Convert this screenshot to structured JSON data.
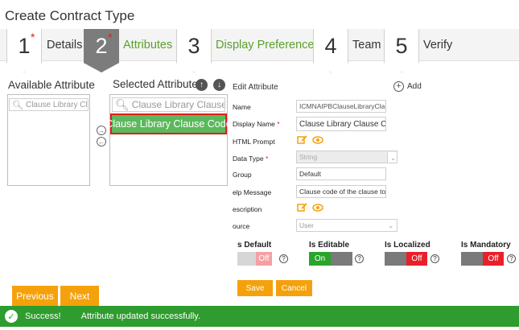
{
  "page": {
    "title": "Create Contract Type"
  },
  "wizard": {
    "steps": [
      {
        "number": "1",
        "label": "Details",
        "required_mark": "*"
      },
      {
        "number": "2",
        "label": "Attributes",
        "required_mark": "*"
      },
      {
        "number": "3",
        "label": "Display Preference"
      },
      {
        "number": "4",
        "label": "Team"
      },
      {
        "number": "5",
        "label": "Verify"
      }
    ]
  },
  "available": {
    "title": "Available Attribute",
    "search_placeholder": "Clause Library Clause Code"
  },
  "selected": {
    "title": "Selected Attribute",
    "search_placeholder": "Clause Library Clause Code",
    "items": [
      "Clause Library Clause Code"
    ]
  },
  "edit": {
    "title": "Edit  Attribute",
    "add_label": "Add",
    "required_mark": "*",
    "fields": {
      "name": {
        "label": "Name",
        "value": "ICMNAIPBClauseLibraryClauseC"
      },
      "display_name": {
        "label": "Display Name",
        "value": "Clause Library Clause Code"
      },
      "html_prompt": {
        "label": "HTML Prompt"
      },
      "data_type": {
        "label": "Data Type",
        "value": "String"
      },
      "group": {
        "label": "Group",
        "value": "Default"
      },
      "help_message": {
        "label": "elp Message",
        "value": "Clause code of the clause to wh"
      },
      "description": {
        "label": "escription"
      },
      "source": {
        "label": "ource",
        "value": "User"
      }
    },
    "toggles": [
      {
        "label": "s Default",
        "state": "Off"
      },
      {
        "label": "Is Editable",
        "state": "On"
      },
      {
        "label": "Is Localized",
        "state": "Off"
      },
      {
        "label": "Is Mandatory",
        "state": "Off"
      }
    ],
    "help_glyph": "?",
    "save_label": "Save",
    "cancel_label": "Cancel"
  },
  "nav": {
    "previous_label": "Previous",
    "next_label": "Next"
  },
  "notification": {
    "status": "Success!",
    "message": "Attribute updated successfully."
  },
  "colors": {
    "accent_orange": "#f5a10c",
    "success_green": "#2e9c2e",
    "toggle_on": "#2aa52a",
    "toggle_off": "#e8202a",
    "selected_item": "#5cb85c",
    "step_label_green": "#5aa02c"
  }
}
